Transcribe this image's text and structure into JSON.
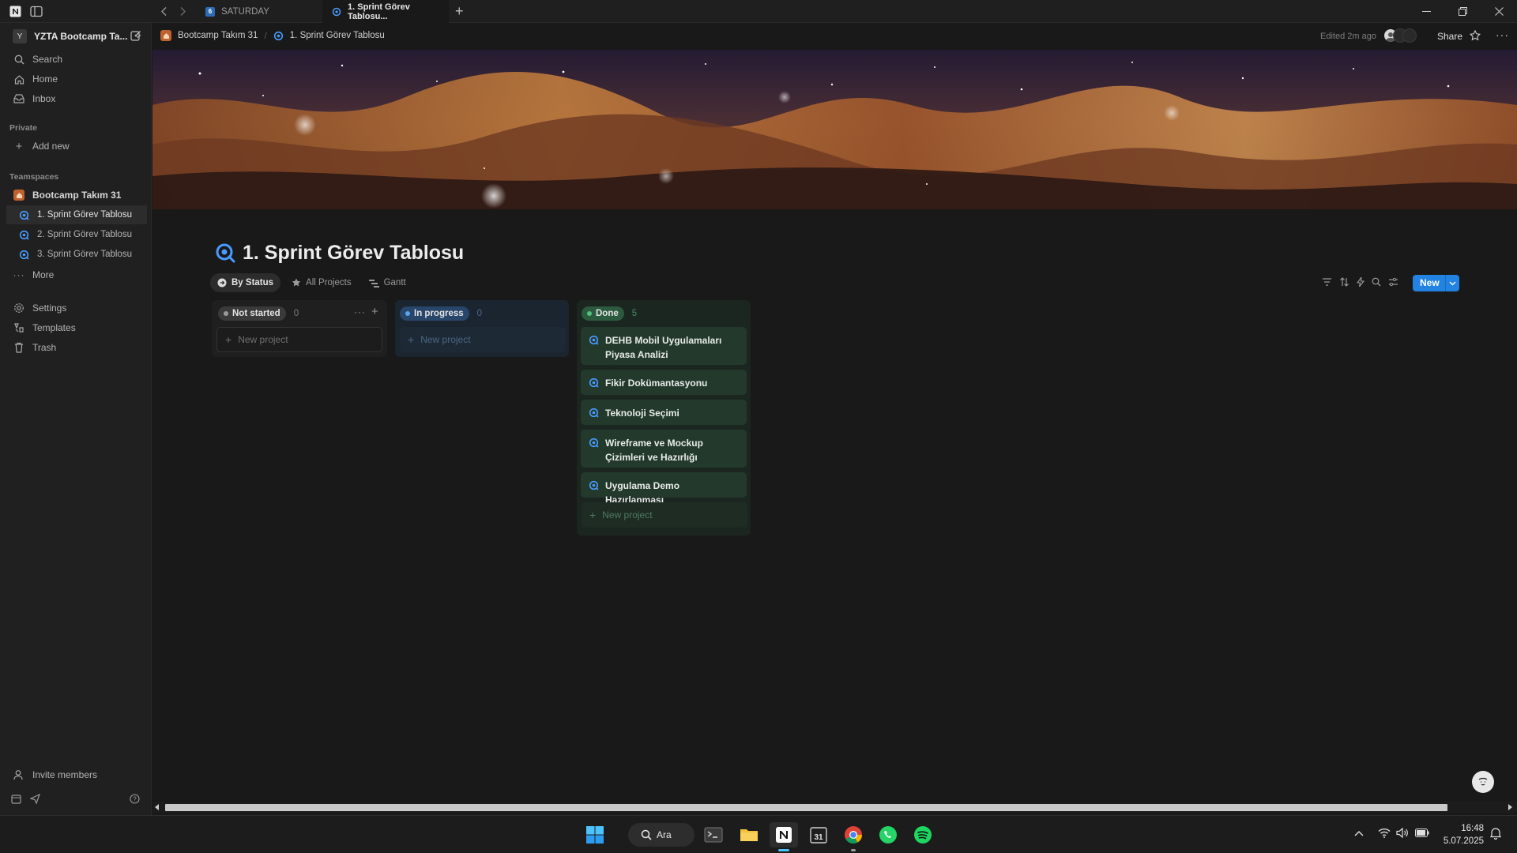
{
  "browser": {
    "tabs": [
      {
        "label": "SATURDAY",
        "active": false
      },
      {
        "label": "1. Sprint Görev Tablosu...",
        "active": true
      }
    ]
  },
  "sidebar": {
    "workspace_badge": "Y",
    "workspace_name": "YZTA Bootcamp Ta...",
    "top_items": [
      {
        "label": "Search",
        "icon": "search-icon"
      },
      {
        "label": "Home",
        "icon": "home-icon"
      },
      {
        "label": "Inbox",
        "icon": "inbox-icon"
      }
    ],
    "private_section": "Private",
    "add_new": "Add new",
    "teamspaces_section": "Teamspaces",
    "teamspace": "Bootcamp Takım 31",
    "pages": [
      {
        "label": "1. Sprint Görev Tablosu",
        "selected": true
      },
      {
        "label": "2. Sprint Görev Tablosu",
        "selected": false
      },
      {
        "label": "3. Sprint Görev Tablosu",
        "selected": false
      }
    ],
    "more": "More",
    "bottom_items": [
      {
        "label": "Settings",
        "icon": "gear-icon"
      },
      {
        "label": "Templates",
        "icon": "templates-icon"
      },
      {
        "label": "Trash",
        "icon": "trash-icon"
      }
    ],
    "invite": "Invite members"
  },
  "topbar": {
    "breadcrumb": [
      "Bootcamp Takım 31",
      "1. Sprint Görev Tablosu"
    ],
    "edited": "Edited 2m ago",
    "share": "Share"
  },
  "page": {
    "title": "1. Sprint Görev Tablosu",
    "views": [
      {
        "label": "By Status",
        "active": true
      },
      {
        "label": "All Projects",
        "active": false
      },
      {
        "label": "Gantt",
        "active": false
      }
    ],
    "new_button": "New"
  },
  "board": {
    "new_item_label": "New project",
    "columns": [
      {
        "status": "Not started",
        "count": "0",
        "color": "#5a5a5a",
        "items": []
      },
      {
        "status": "In progress",
        "count": "0",
        "color": "#2a4a6b",
        "items": []
      },
      {
        "status": "Done",
        "count": "5",
        "color": "#2b5a3f",
        "items": [
          "DEHB Mobil Uygulamaları Piyasa Analizi",
          "Fikir Dokümantasyonu",
          "Teknoloji Seçimi",
          "Wireframe ve Mockup Çizimleri ve Hazırlığı",
          "Uygulama Demo Hazırlanması"
        ]
      }
    ]
  },
  "taskbar": {
    "search_label": "Ara",
    "time": "16:48",
    "date": "5.07.2025"
  },
  "colors": {
    "accent": "#2383e2",
    "done_card": "#23392c",
    "background": "#191919"
  }
}
